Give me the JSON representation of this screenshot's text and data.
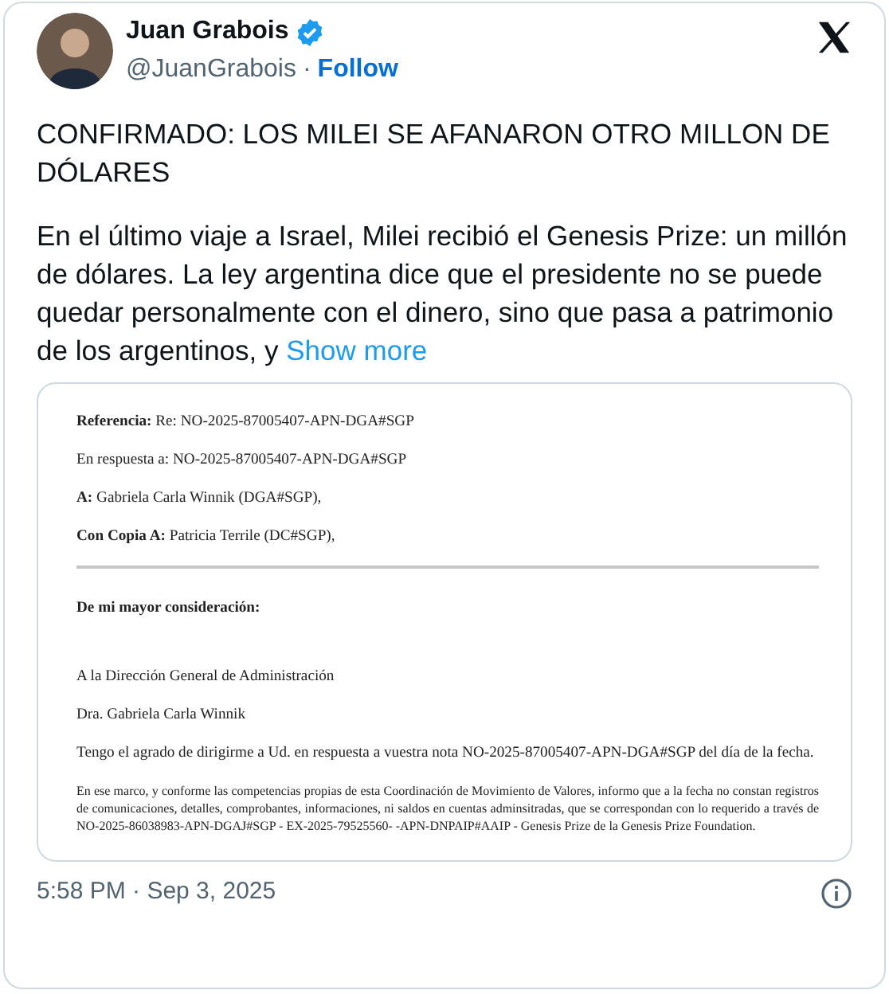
{
  "author": {
    "name": "Juan Grabois",
    "verified": true,
    "handle": "@JuanGrabois",
    "separator": "·",
    "follow": "Follow"
  },
  "headline": "CONFIRMADO: LOS MILEI SE AFANARON OTRO MILLON DE DÓLARES",
  "body": {
    "text": "En el último viaje a Israel, Milei recibió el Genesis Prize: un millón de dólares. La ley argentina dice que el presidente no se puede quedar personalmente con el dinero, sino que pasa a patrimonio de los argentinos, y",
    "more": "Show more"
  },
  "document": {
    "lines": [
      {
        "kind": "field",
        "text": "**Referencia:** Re: NO-2025-87005407-APN-DGA#SGP"
      },
      {
        "kind": "field",
        "text": "En respuesta a: NO-2025-87005407-APN-DGA#SGP"
      },
      {
        "kind": "field",
        "text": "**A:** Gabriela Carla Winnik (DGA#SGP),"
      },
      {
        "kind": "field",
        "text": "**Con Copia A:** Patricia Terrile (DC#SGP),"
      },
      {
        "kind": "rule"
      },
      {
        "kind": "heading",
        "text": "De mi mayor consideración:"
      },
      {
        "kind": "text",
        "text": "A la Dirección General de Administración"
      },
      {
        "kind": "text",
        "text": "Dra. Gabriela Carla Winnik"
      },
      {
        "kind": "text",
        "text": "Tengo el agrado de dirigirme a Ud. en respuesta a vuestra nota NO-2025-87005407-APN-DGA#SGP del día de la fecha."
      },
      {
        "kind": "small",
        "text": "En ese marco, y conforme las competencias propias de esta Coordinación de Movimiento de Valores, informo que a la fecha no constan registros de comunicaciones, detalles, comprobantes, informaciones, ni saldos en cuentas adminsitradas, que se correspondan con lo requerido a través de NO-2025-86038983-APN-DGAJ#SGP - EX-2025-79525560- -APN-DNPAIP#AAIP - Genesis Prize de la Genesis Prize Foundation."
      }
    ]
  },
  "timestamp": "5:58 PM · Sep 3, 2025"
}
